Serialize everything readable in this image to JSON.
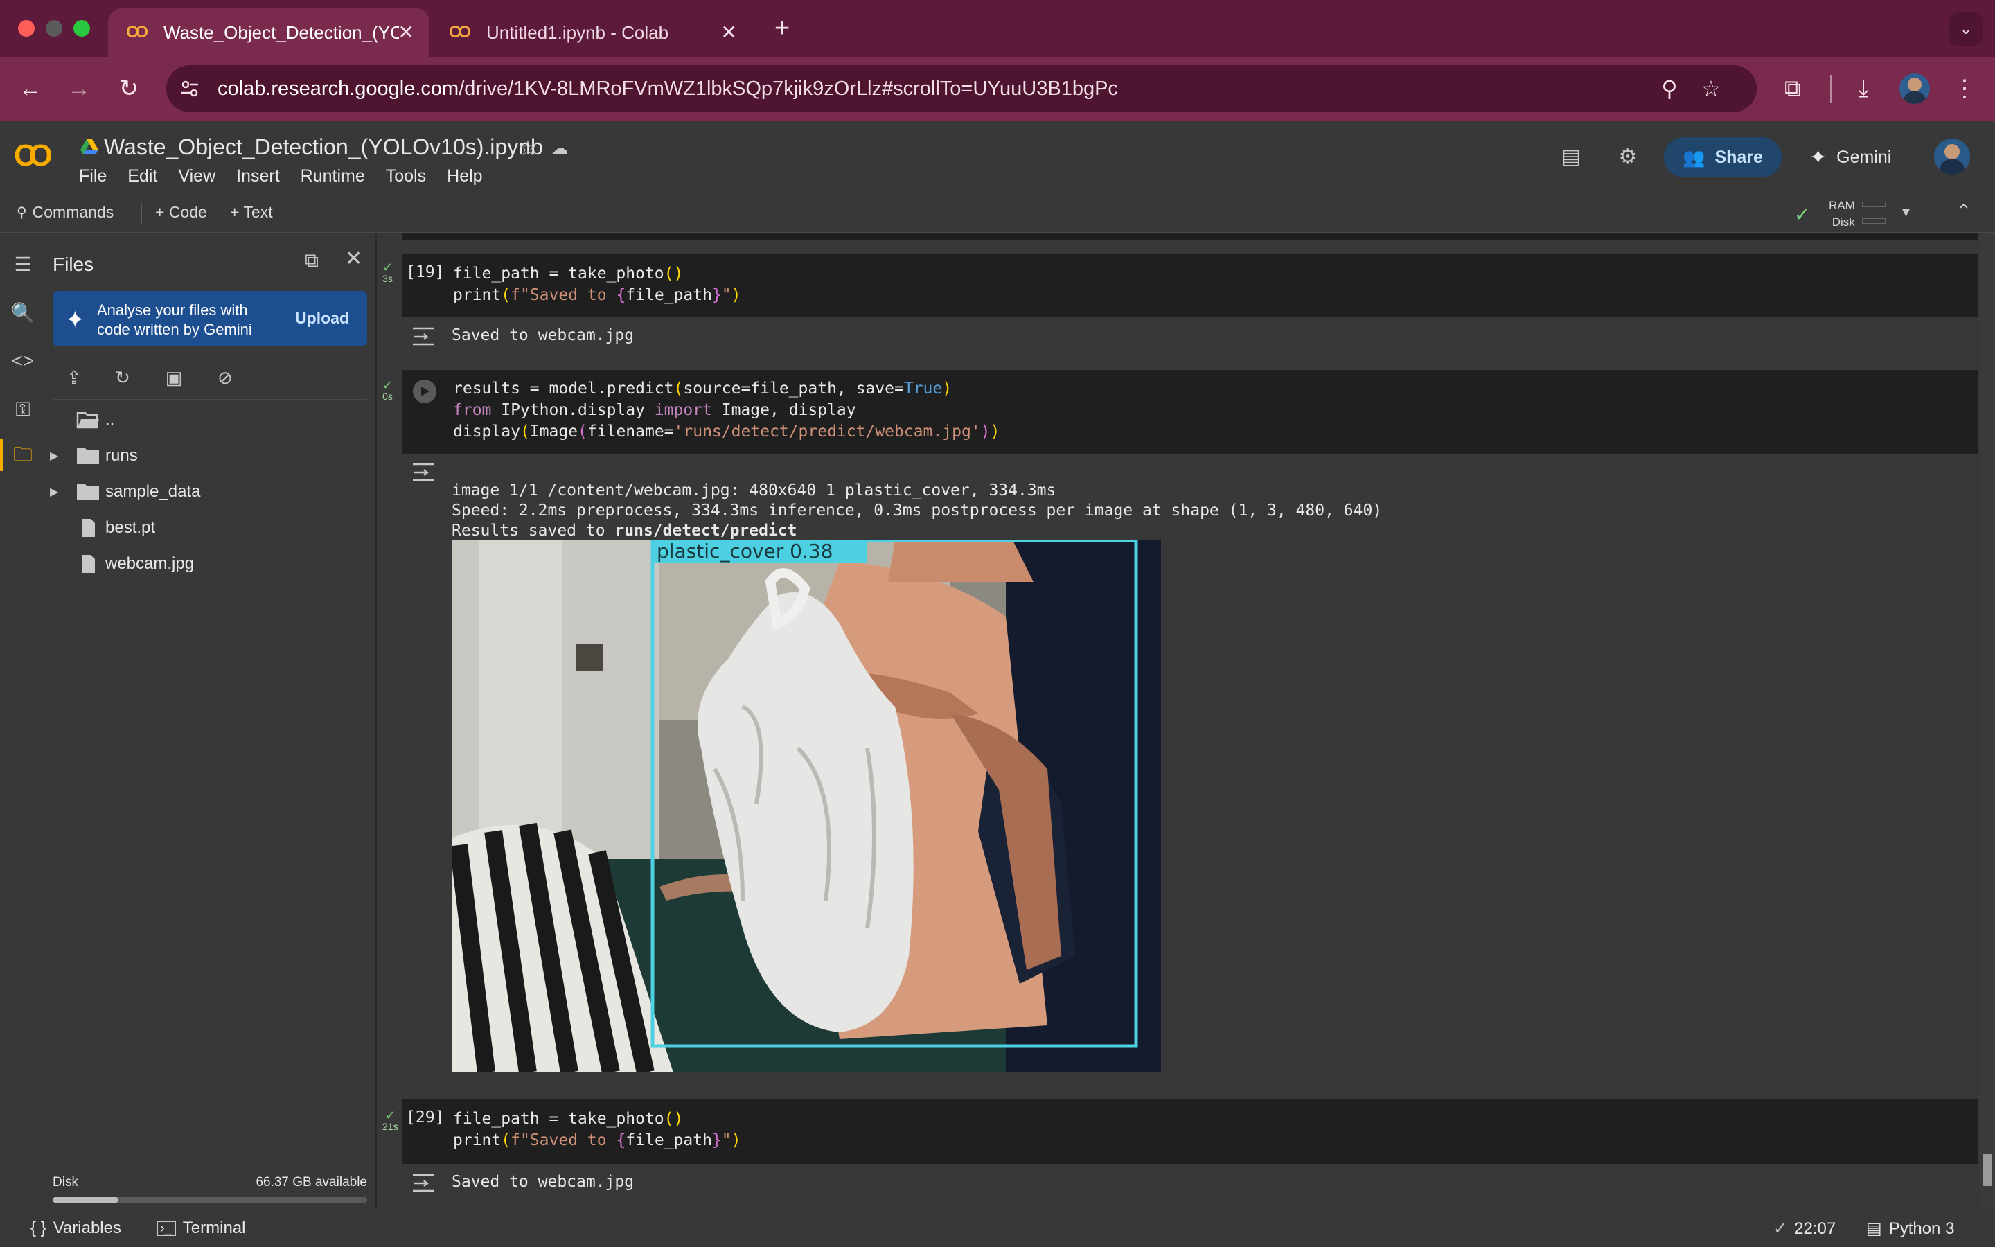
{
  "browser": {
    "tabs": [
      {
        "title": "Waste_Object_Detection_(YC",
        "active": true
      },
      {
        "title": "Untitled1.ipynb - Colab",
        "active": false
      }
    ],
    "url_host": "colab.research.google.com",
    "url_path": "/drive/1KV-8LMRoFVmWZ1lbkSQp7kjik9zOrLlz#scrollTo=UYuuU3B1bgPc",
    "theme_color": "#7a2a4c"
  },
  "colab": {
    "notebook_title": "Waste_Object_Detection_(YOLOv10s).ipynb",
    "menus": [
      "File",
      "Edit",
      "View",
      "Insert",
      "Runtime",
      "Tools",
      "Help"
    ],
    "share_label": "Share",
    "gemini_label": "Gemini",
    "toolbar": {
      "commands": "Commands",
      "add_code": "+ Code",
      "add_text": "+ Text",
      "ram": "RAM",
      "disk": "Disk"
    }
  },
  "files_panel": {
    "title": "Files",
    "banner_text": "Analyse your files with code written by Gemini",
    "upload_label": "Upload",
    "items": [
      {
        "name": "..",
        "type": "parent"
      },
      {
        "name": "runs",
        "type": "folder"
      },
      {
        "name": "sample_data",
        "type": "folder"
      },
      {
        "name": "best.pt",
        "type": "file"
      },
      {
        "name": "webcam.jpg",
        "type": "file"
      }
    ],
    "disk_label": "Disk",
    "disk_available": "66.37 GB available",
    "disk_used_fraction": 0.21
  },
  "cells": {
    "c1": {
      "exec_count": "[19]",
      "time": "3s",
      "output": "Saved to webcam.jpg"
    },
    "c2": {
      "time": "0s",
      "output_line1": "image 1/1 /content/webcam.jpg: 480x640 1 plastic_cover, 334.3ms",
      "output_line2": "Speed: 2.2ms preprocess, 334.3ms inference, 0.3ms postprocess per image at shape (1, 3, 480, 640)",
      "output_line3_prefix": "Results saved to ",
      "output_line3_path": "runs/detect/predict",
      "detection_label": "plastic_cover 0.38",
      "box_color": "#4dd0e1"
    },
    "c3": {
      "exec_count": "[29]",
      "time": "21s",
      "output": "Saved to webcam.jpg"
    }
  },
  "statusbar": {
    "variables": "Variables",
    "terminal": "Terminal",
    "time": "22:07",
    "runtime": "Python 3"
  }
}
